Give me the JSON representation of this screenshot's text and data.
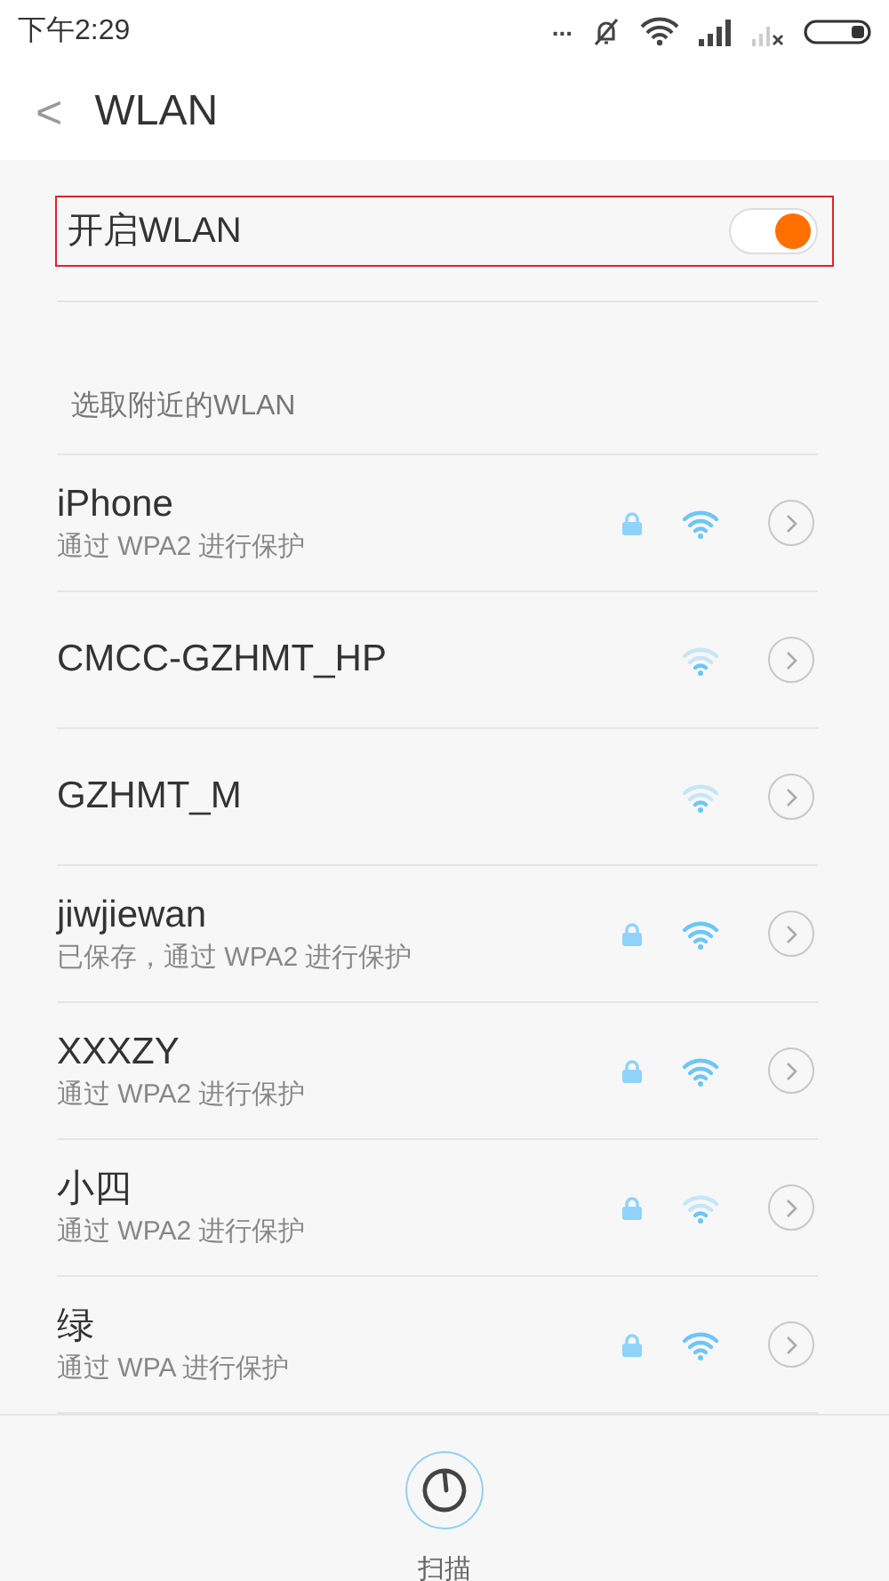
{
  "status_bar": {
    "time": "下午2:29",
    "more": "..."
  },
  "header": {
    "back": "<",
    "title": "WLAN"
  },
  "wlan_switch": {
    "label": "开启WLAN",
    "on": true,
    "highlighted": true
  },
  "section_title": "选取附近的WLAN",
  "networks": [
    {
      "name": "iPhone",
      "detail": "通过 WPA2 进行保护",
      "locked": true,
      "strong_signal": true
    },
    {
      "name": "CMCC-GZHMT_HP",
      "locked": false,
      "strong_signal": false
    },
    {
      "name": "GZHMT_M",
      "locked": false,
      "strong_signal": false
    },
    {
      "name": "jiwjiewan",
      "detail": "已保存，通过 WPA2 进行保护",
      "locked": true,
      "strong_signal": true
    },
    {
      "name": "XXXZY",
      "detail": "通过 WPA2 进行保护",
      "locked": true,
      "strong_signal": true
    },
    {
      "name": "小四",
      "detail": "通过 WPA2 进行保护",
      "locked": true,
      "strong_signal": false
    },
    {
      "name": "绿",
      "detail": "通过 WPA 进行保护",
      "locked": true,
      "strong_signal": true
    }
  ],
  "bottom_bar": {
    "scan_label": "扫描"
  }
}
